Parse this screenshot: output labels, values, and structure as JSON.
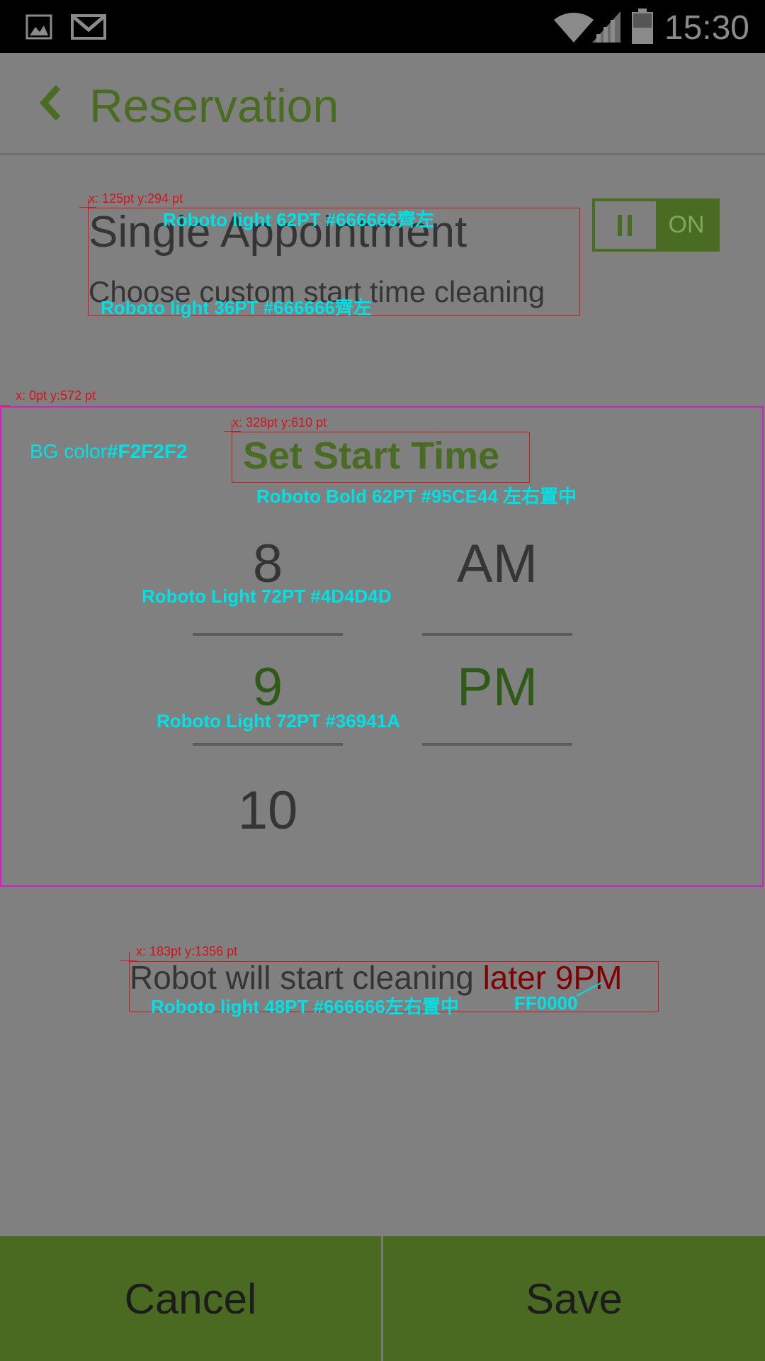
{
  "status_bar": {
    "time": "15:30",
    "icons": [
      "image-icon",
      "gmail-icon",
      "wifi-icon",
      "signal-icon",
      "battery-icon"
    ]
  },
  "header": {
    "back_icon": "chevron-left-icon",
    "title": "Reservation"
  },
  "appointment": {
    "title": "Single Appointment",
    "subtitle": "Choose custom start time cleaning",
    "toggle": {
      "label": "ON",
      "off_glyph": "II",
      "state": "on"
    }
  },
  "picker": {
    "heading": "Set Start Time",
    "hours": [
      "8",
      "9",
      "10"
    ],
    "selected_hour": "9",
    "periods": [
      "AM",
      "PM"
    ],
    "selected_period": "PM"
  },
  "status_message": {
    "prefix": "Robot will start cleaning ",
    "highlight": "later 9PM"
  },
  "footer": {
    "cancel_label": "Cancel",
    "save_label": "Save"
  },
  "annotations": {
    "appt_coord": "x: 125pt y:294 pt",
    "appt_title_spec": "Roboto light  62PT #666666齊左",
    "appt_sub_spec": "Roboto light  36PT #666666齊左",
    "section_coord": "x: 0pt y:572 pt",
    "bg_color_prefix": "BG color",
    "bg_color_value": "#F2F2F2",
    "heading_coord": "x: 328pt y:610 pt",
    "heading_spec": "Roboto Bold 62PT #95CE44 左右置中",
    "unselected_spec": "Roboto Light 72PT #4D4D4D",
    "selected_spec": "Roboto Light 72PT #36941A",
    "status_coord": "x: 183pt y:1356 pt",
    "status_spec": "Roboto light  48PT #666666左右置中",
    "red_spec": "FF0000"
  },
  "colors": {
    "overlay_bg": "#808080",
    "accent_green": "#4a6c22",
    "annotation_red": "#d4131b",
    "annotation_cyan": "#00e1e6",
    "section_border": "#d020c8"
  }
}
